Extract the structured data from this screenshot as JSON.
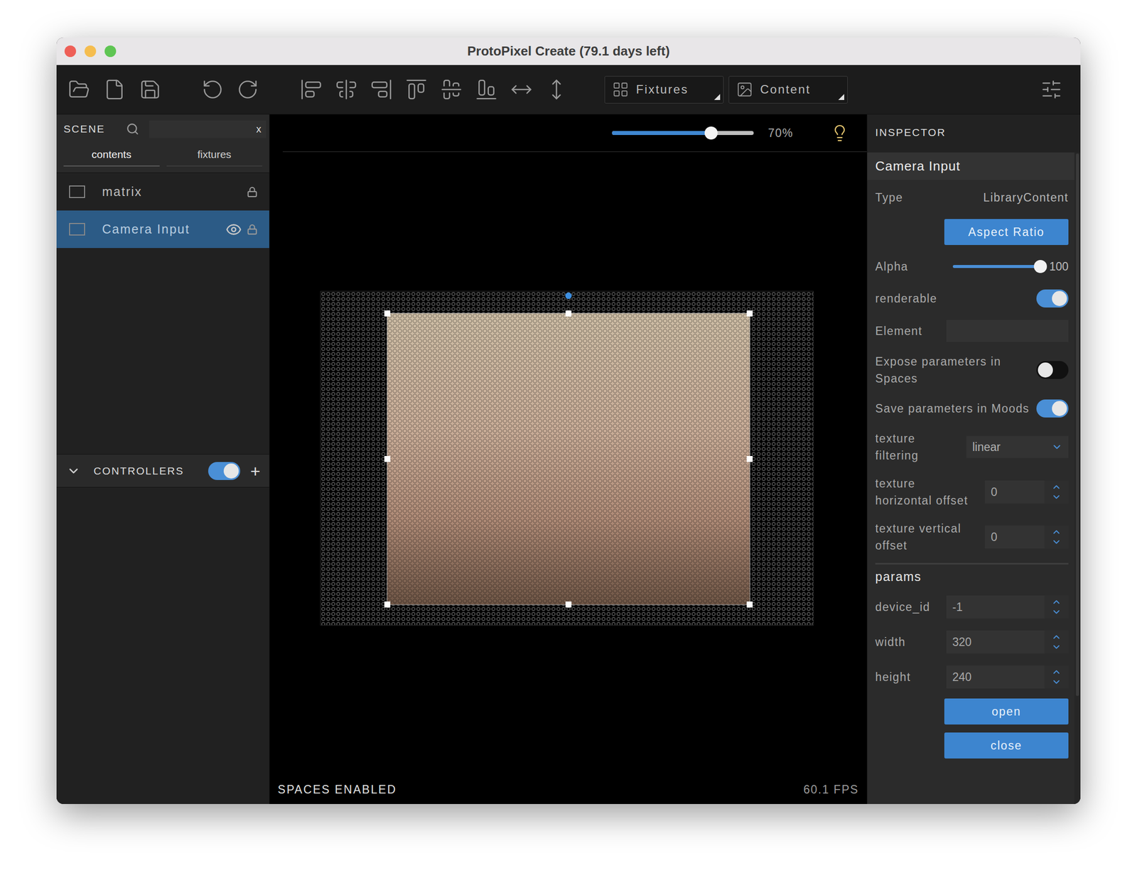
{
  "window": {
    "title": "ProtoPixel Create (79.1 days left)"
  },
  "toolbar": {
    "dropdowns": [
      {
        "label": "Fixtures"
      },
      {
        "label": "Content"
      }
    ]
  },
  "scene": {
    "title": "SCENE",
    "search": {
      "value": "",
      "clear": "x"
    },
    "tabs": [
      {
        "label": "contents",
        "selected": true
      },
      {
        "label": "fixtures",
        "selected": false
      }
    ],
    "items": [
      {
        "name": "matrix",
        "checked": false,
        "selected": false,
        "visible": false,
        "locked": true
      },
      {
        "name": "Camera Input",
        "checked": false,
        "selected": true,
        "visible": true,
        "locked": true
      }
    ]
  },
  "controllers": {
    "title": "CONTROLLERS",
    "expanded": true,
    "enabled": true,
    "add": "+"
  },
  "viewport": {
    "zoom": {
      "level": 0.7,
      "reading": "70%"
    },
    "status": "SPACES ENABLED",
    "fps": "60.1 FPS"
  },
  "inspector": {
    "title": "INSPECTOR",
    "section": "Camera Input",
    "rows": [
      {
        "kind": "text",
        "label": "Type",
        "value": "LibraryContent"
      },
      {
        "kind": "button",
        "label": "Aspect Ratio"
      },
      {
        "kind": "slider",
        "label": "Alpha",
        "level": 1,
        "reading": "100"
      },
      {
        "kind": "toggle",
        "label": "renderable",
        "on": true
      },
      {
        "kind": "field",
        "label": "Element",
        "value": ""
      },
      {
        "kind": "toggle",
        "label": "Expose parameters in Spaces",
        "on": false
      },
      {
        "kind": "toggle",
        "label": "Save parameters in Moods",
        "on": true
      },
      {
        "kind": "select",
        "label": "texture filtering",
        "value": "linear"
      },
      {
        "kind": "number",
        "label": "texture horizontal offset",
        "value": "0"
      },
      {
        "kind": "number",
        "label": "texture vertical offset",
        "value": "0"
      }
    ],
    "params_title": "params",
    "params": [
      {
        "kind": "number",
        "label": "device_id",
        "value": "-1"
      },
      {
        "kind": "number",
        "label": "width",
        "value": "320"
      },
      {
        "kind": "number",
        "label": "height",
        "value": "240"
      },
      {
        "kind": "button",
        "label": "open"
      },
      {
        "kind": "button",
        "label": "close"
      }
    ]
  }
}
